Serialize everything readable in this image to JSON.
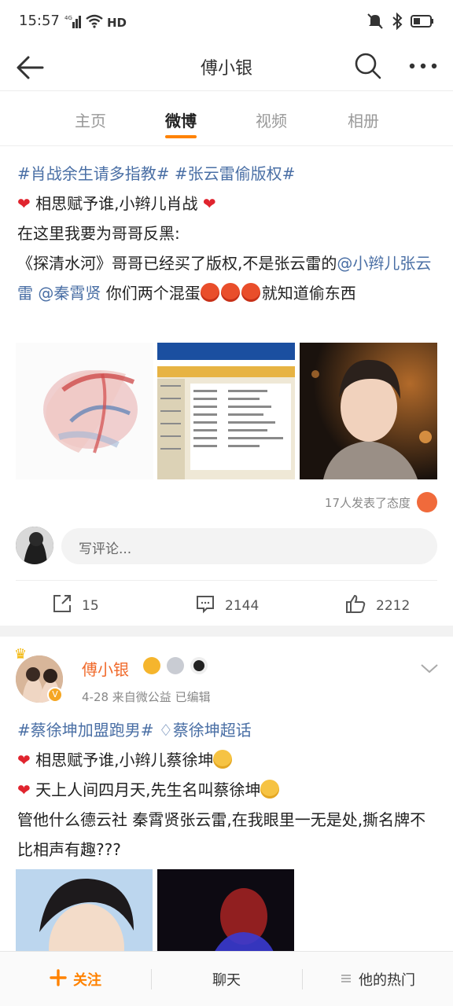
{
  "status_bar": {
    "time": "15:57",
    "network": "4G",
    "hd": "HD"
  },
  "nav": {
    "title": "傅小银"
  },
  "tabs": [
    {
      "label": "主页",
      "active": false
    },
    {
      "label": "微博",
      "active": true
    },
    {
      "label": "视频",
      "active": false
    },
    {
      "label": "相册",
      "active": false
    }
  ],
  "post1": {
    "topic_line": "#肖战余生请多指教#  #张云雷偷版权#",
    "line2": "相思赋予谁,小辫儿肖战",
    "line3": "在这里我要为哥哥反黑:",
    "line4_a": "《探清水河》哥哥已经买了版权,不是张云雷的",
    "mention1": "@小辫儿张云雷",
    "mention2": "@秦霄贤",
    "line4_b": "你们两个混蛋",
    "line4_c": "就知道偷东西",
    "reactions": "17人发表了态度",
    "comment_placeholder": "写评论...",
    "reposts": "15",
    "comments": "2144",
    "likes": "2212"
  },
  "post2": {
    "author": "傅小银",
    "meta": "4-28  来自微公益  已编辑",
    "topic1": "#蔡徐坤加盟跑男#",
    "topic2": "蔡徐坤超话",
    "line2": "相思赋予谁,小辫儿蔡徐坤",
    "line3": "天上人间四月天,先生名叫蔡徐坤",
    "line4": "管他什么德云社 秦霄贤张云雷,在我眼里一无是处,撕名牌不比相声有趣???"
  },
  "bottom_bar": {
    "follow": "关注",
    "chat": "聊天",
    "hot": "他的热门"
  },
  "colors": {
    "accent": "#ff8200",
    "topic": "#4a6fa5",
    "heart": "#e0242e"
  }
}
